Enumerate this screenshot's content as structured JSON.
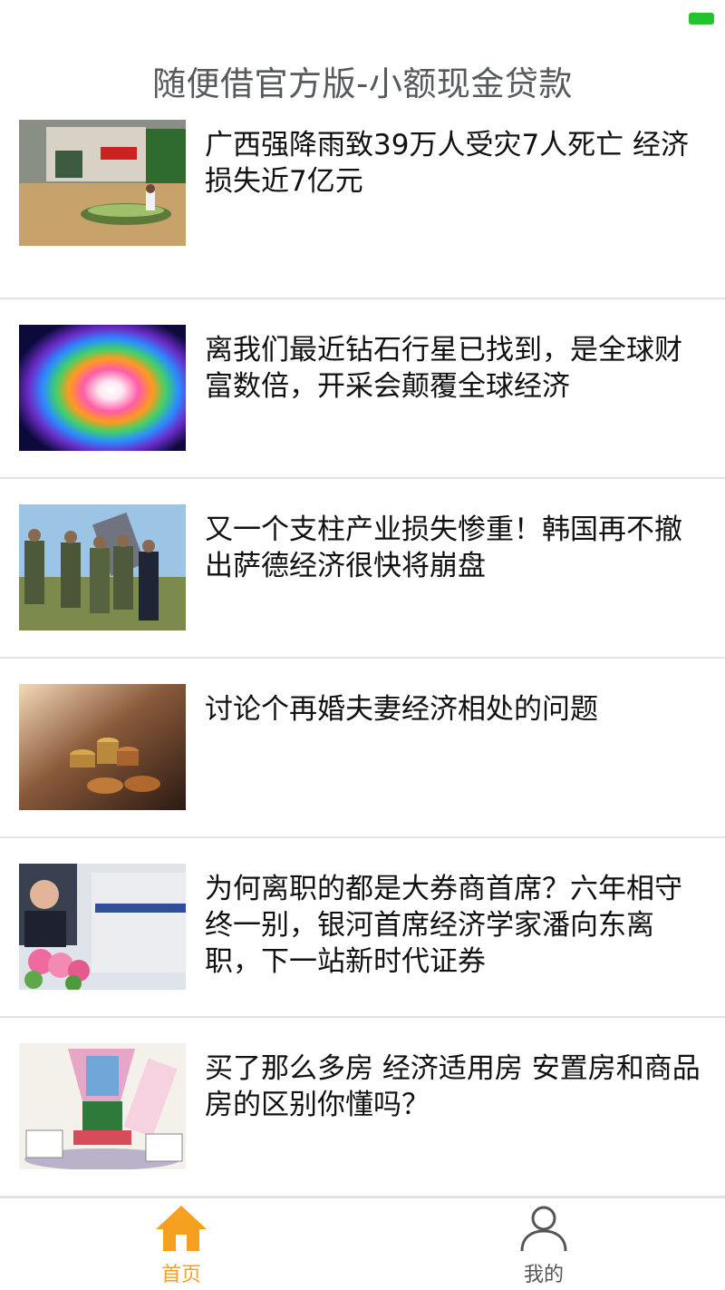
{
  "app": {
    "title": "随便借官方版-小额现金贷款",
    "accent_color": "#f5a020",
    "battery_color": "#22c32e"
  },
  "feed": {
    "items": [
      {
        "headline": "广西强降雨致39万人受灾7人死亡 经济损失近7亿元",
        "thumb": "flood-photo"
      },
      {
        "headline": "离我们最近钻石行星已找到，是全球财富数倍，开采会颠覆全球经济",
        "thumb": "galaxy-photo"
      },
      {
        "headline": "又一个支柱产业损失惨重！韩国再不撤出萨德经济很快将崩盘",
        "thumb": "military-photo"
      },
      {
        "headline": "讨论个再婚夫妻经济相处的问题",
        "thumb": "coins-photo"
      },
      {
        "headline": "为何离职的都是大券商首席？六年相守终一别，银河首席经济学家潘向东离职，下一站新时代证券",
        "thumb": "economist-photo"
      },
      {
        "headline": "买了那么多房 经济适用房 安置房和商品房的区别你懂吗？",
        "thumb": "housing-cartoon"
      }
    ]
  },
  "tabbar": {
    "home_label": "首页",
    "home_icon": "home-icon",
    "mine_label": "我的",
    "mine_icon": "user-icon"
  }
}
